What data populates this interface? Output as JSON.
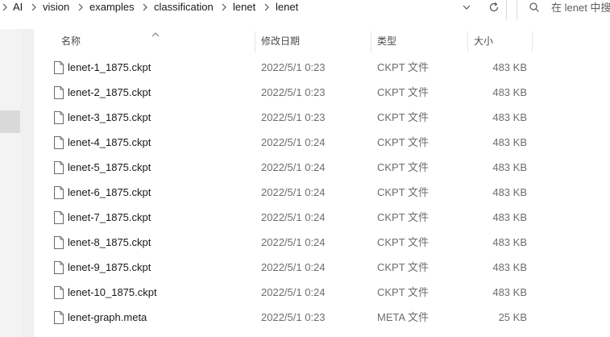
{
  "breadcrumb": {
    "items": [
      "AI",
      "vision",
      "examples",
      "classification",
      "lenet",
      "lenet"
    ]
  },
  "toolbar": {
    "history_icon": "chevron-down-icon",
    "refresh_icon": "refresh-icon"
  },
  "search": {
    "placeholder": "在 lenet 中搜",
    "icon": "search-icon"
  },
  "columns": {
    "name": "名称",
    "date": "修改日期",
    "type": "类型",
    "size": "大小"
  },
  "files": [
    {
      "name": "lenet-1_1875.ckpt",
      "date": "2022/5/1 0:23",
      "type": "CKPT 文件",
      "size": "483 KB"
    },
    {
      "name": "lenet-2_1875.ckpt",
      "date": "2022/5/1 0:23",
      "type": "CKPT 文件",
      "size": "483 KB"
    },
    {
      "name": "lenet-3_1875.ckpt",
      "date": "2022/5/1 0:23",
      "type": "CKPT 文件",
      "size": "483 KB"
    },
    {
      "name": "lenet-4_1875.ckpt",
      "date": "2022/5/1 0:24",
      "type": "CKPT 文件",
      "size": "483 KB"
    },
    {
      "name": "lenet-5_1875.ckpt",
      "date": "2022/5/1 0:24",
      "type": "CKPT 文件",
      "size": "483 KB"
    },
    {
      "name": "lenet-6_1875.ckpt",
      "date": "2022/5/1 0:24",
      "type": "CKPT 文件",
      "size": "483 KB"
    },
    {
      "name": "lenet-7_1875.ckpt",
      "date": "2022/5/1 0:24",
      "type": "CKPT 文件",
      "size": "483 KB"
    },
    {
      "name": "lenet-8_1875.ckpt",
      "date": "2022/5/1 0:24",
      "type": "CKPT 文件",
      "size": "483 KB"
    },
    {
      "name": "lenet-9_1875.ckpt",
      "date": "2022/5/1 0:24",
      "type": "CKPT 文件",
      "size": "483 KB"
    },
    {
      "name": "lenet-10_1875.ckpt",
      "date": "2022/5/1 0:24",
      "type": "CKPT 文件",
      "size": "483 KB"
    },
    {
      "name": "lenet-graph.meta",
      "date": "2022/5/1 0:23",
      "type": "META 文件",
      "size": "25 KB"
    }
  ],
  "colors": {
    "selected_nav": "#d9d9d9",
    "pane_bg": "#f3f3f3",
    "muted_text": "#6d6d6d"
  }
}
